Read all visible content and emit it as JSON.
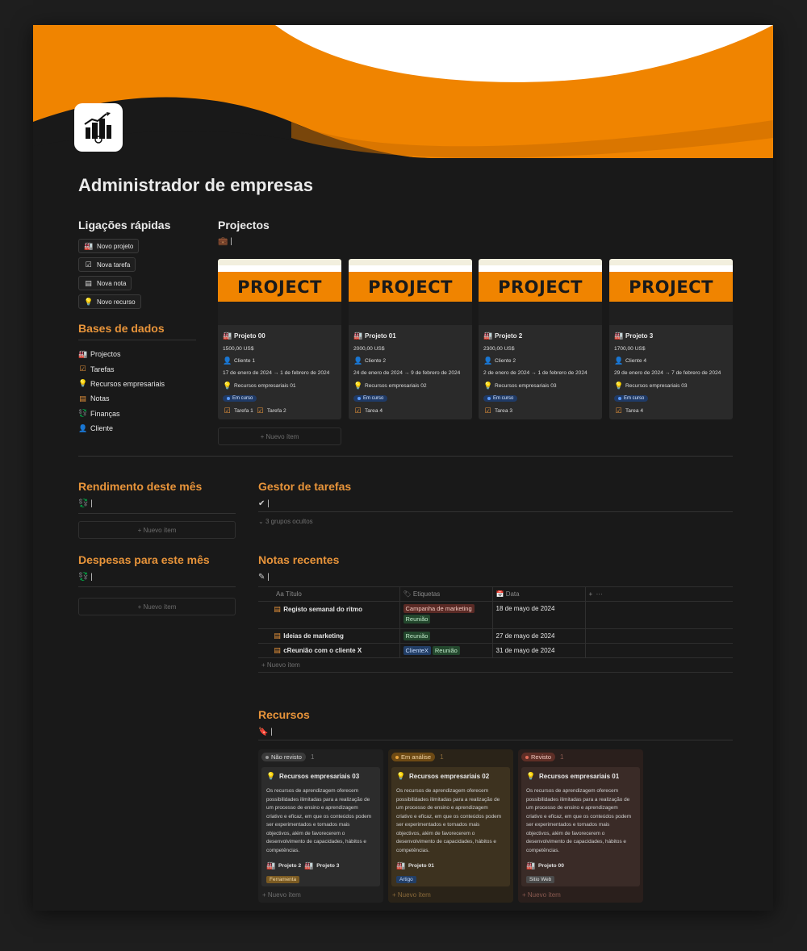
{
  "title": "Administrador de empresas",
  "quick_links": {
    "heading": "Ligações rápidas",
    "buttons": [
      {
        "icon": "factory-icon",
        "label": "Novo projeto"
      },
      {
        "icon": "checkbox-icon",
        "label": "Nova tarefa"
      },
      {
        "icon": "note-icon",
        "label": "Nova nota"
      },
      {
        "icon": "lightbulb-icon",
        "label": "Novo recurso"
      }
    ]
  },
  "databases": {
    "heading": "Bases de dados",
    "items": [
      "Projectos",
      "Tarefas",
      "Recursos empresariais",
      "Notas",
      "Finanças",
      "Cliente"
    ]
  },
  "projects": {
    "heading": "Projectos",
    "cover_text": "PROJECT",
    "new_item": "+ Nuevo ítem",
    "cards": [
      {
        "name": "Projeto 00",
        "amount": "1500,00 US$",
        "client": "Cliente 1",
        "dates": "17 de enero de 2024 → 1 de febrero de 2024",
        "resource": "Recursos empresariais 01",
        "status": "Em curso",
        "tasks": [
          "Tarefa 1",
          "Tarefa 2"
        ]
      },
      {
        "name": "Projeto 01",
        "amount": "2000,00 US$",
        "client": "Cliente 2",
        "dates": "24 de enero de 2024 → 9 de febrero de 2024",
        "resource": "Recursos empresariais 02",
        "status": "Em curso",
        "tasks": [
          "Tarea 4"
        ]
      },
      {
        "name": "Projeto 2",
        "amount": "2300,00 US$",
        "client": "Cliente 2",
        "dates": "2 de enero de 2024 → 1 de febrero de 2024",
        "resource": "Recursos empresariais 03",
        "status": "Em curso",
        "tasks": [
          "Tarea 3"
        ]
      },
      {
        "name": "Projeto 3",
        "amount": "1700,00 US$",
        "client": "Cliente 4",
        "dates": "29 de enero de 2024 → 7 de febrero de 2024",
        "resource": "Recursos empresariais 03",
        "status": "Em curso",
        "tasks": [
          "Tarea 4"
        ]
      }
    ]
  },
  "income": {
    "heading": "Rendimento deste mês",
    "new_item": "+ Nuevo ítem"
  },
  "expenses": {
    "heading": "Despesas para este mês",
    "new_item": "+ Nuevo ítem"
  },
  "tasks_manager": {
    "heading": "Gestor de tarefas",
    "hidden_groups": "3 grupos ocultos"
  },
  "notes": {
    "heading": "Notas recentes",
    "columns": [
      "Aa Título",
      "Etiquetas",
      "Data"
    ],
    "rows": [
      {
        "title": "Registo semanal do ritmo",
        "tags": [
          {
            "label": "Campanha de marketing",
            "color": "red"
          },
          {
            "label": "Reunião",
            "color": "green"
          }
        ],
        "date": "18 de mayo de 2024"
      },
      {
        "title": "Ideias de marketing",
        "tags": [
          {
            "label": "Reunião",
            "color": "green"
          }
        ],
        "date": "27 de mayo de 2024"
      },
      {
        "title": "cReunião com o cliente X",
        "tags": [
          {
            "label": "ClienteX",
            "color": "blue"
          },
          {
            "label": "Reunião",
            "color": "green"
          }
        ],
        "date": "31 de mayo de 2024"
      }
    ],
    "new_item": "+ Nuevo ítem"
  },
  "resources": {
    "heading": "Recursos",
    "description": "Os recursos de aprendizagem oferecem possibilidades ilimitadas para a realização de um processo de ensino e aprendizagem criativo e eficaz, em que os conteúdos podem ser experimentados e tornados mais objectivos, além de favorecerem o desenvolvimento de capacidades, hábitos e competências.",
    "new_item": "+ Nuevo ítem",
    "columns": [
      {
        "status": "Não revisto",
        "count": "1",
        "title": "Recursos empresariais 03",
        "projects": [
          "Projeto 2",
          "Projeto 3"
        ],
        "tag": "Ferramenta"
      },
      {
        "status": "Em análise",
        "count": "1",
        "title": "Recursos empresariais 02",
        "projects": [
          "Projeto 01"
        ],
        "tag": "Artigo"
      },
      {
        "status": "Revisto",
        "count": "1",
        "title": "Recursos empresariais 01",
        "projects": [
          "Projeto 00"
        ],
        "tag": "Sitio Web"
      }
    ]
  },
  "colors": {
    "accent": "#e8943a",
    "cover_orange": "#f08400"
  }
}
